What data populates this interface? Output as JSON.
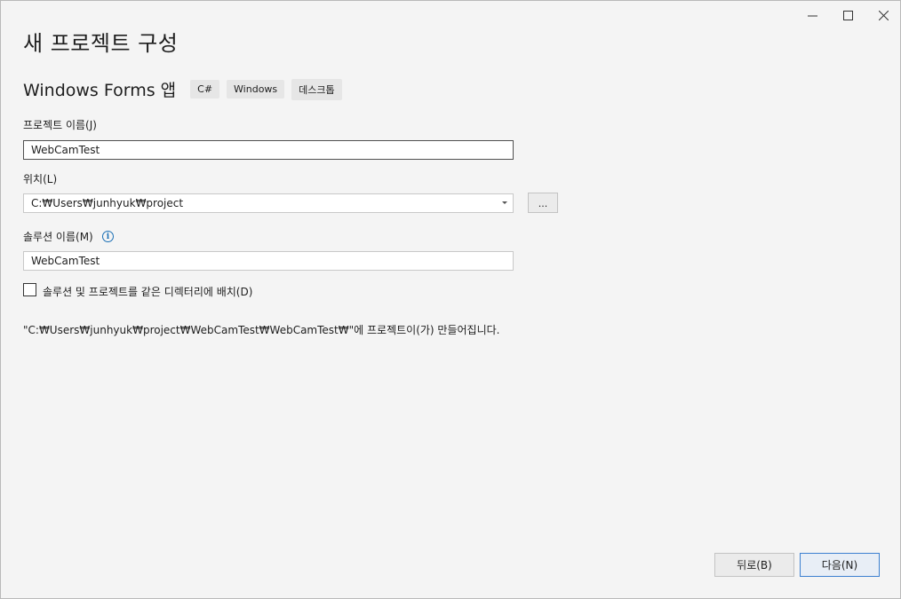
{
  "window": {
    "title": "새 프로젝트 구성"
  },
  "template": {
    "name": "Windows Forms 앱",
    "tags": [
      "C#",
      "Windows",
      "데스크톱"
    ]
  },
  "form": {
    "project_name_label": "프로젝트 이름(J)",
    "project_name_value": "WebCamTest",
    "location_label": "위치(L)",
    "location_value": "C:₩Users₩junhyuk₩project",
    "browse_label": "...",
    "solution_name_label": "솔루션 이름(M)",
    "solution_name_value": "WebCamTest",
    "same_dir_checkbox_label": "솔루션 및 프로젝트를 같은 디렉터리에 배치(D)",
    "same_dir_checked": false,
    "path_note": "\"C:₩Users₩junhyuk₩project₩WebCamTest₩WebCamTest₩\"에 프로젝트이(가) 만들어집니다."
  },
  "buttons": {
    "back": "뒤로(B)",
    "next": "다음(N)"
  }
}
